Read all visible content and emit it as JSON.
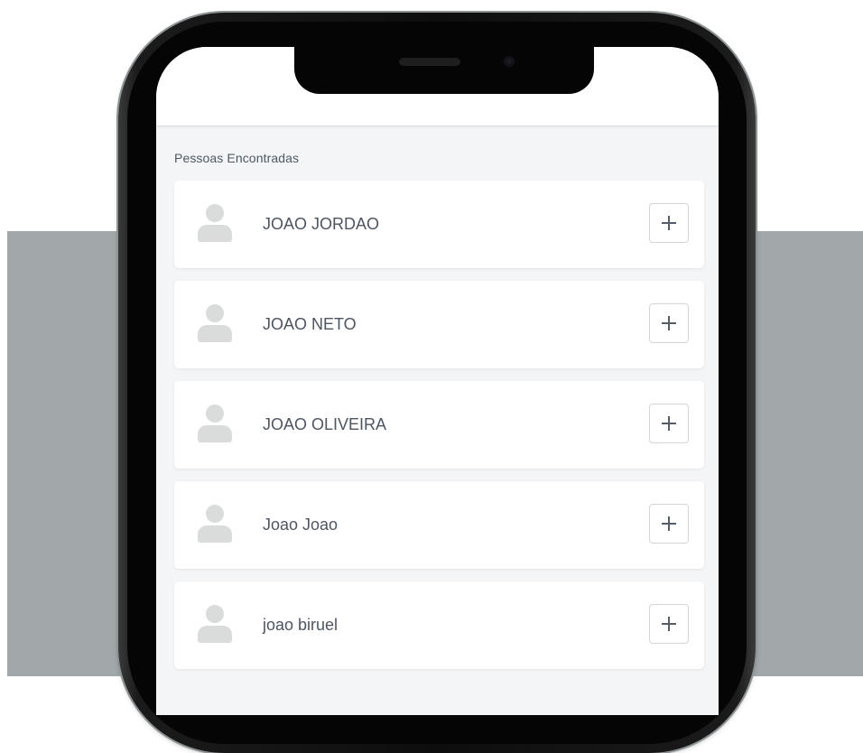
{
  "app": {
    "section_title": "Pessoas Encontradas"
  },
  "people": [
    {
      "name": "JOAO JORDAO",
      "avatar_icon": "user-avatar-icon",
      "action_icon": "plus-icon"
    },
    {
      "name": "JOAO NETO",
      "avatar_icon": "user-avatar-icon",
      "action_icon": "plus-icon"
    },
    {
      "name": "JOAO OLIVEIRA",
      "avatar_icon": "user-avatar-icon",
      "action_icon": "plus-icon"
    },
    {
      "name": "Joao Joao",
      "avatar_icon": "user-avatar-icon",
      "action_icon": "plus-icon"
    },
    {
      "name": "joao biruel",
      "avatar_icon": "user-avatar-icon",
      "action_icon": "plus-icon"
    }
  ],
  "colors": {
    "backdrop": "#a2a7aa",
    "screen_background": "#f4f5f6",
    "card_background": "#ffffff",
    "text": "#4c5561",
    "avatar": "#d9dcdb"
  }
}
